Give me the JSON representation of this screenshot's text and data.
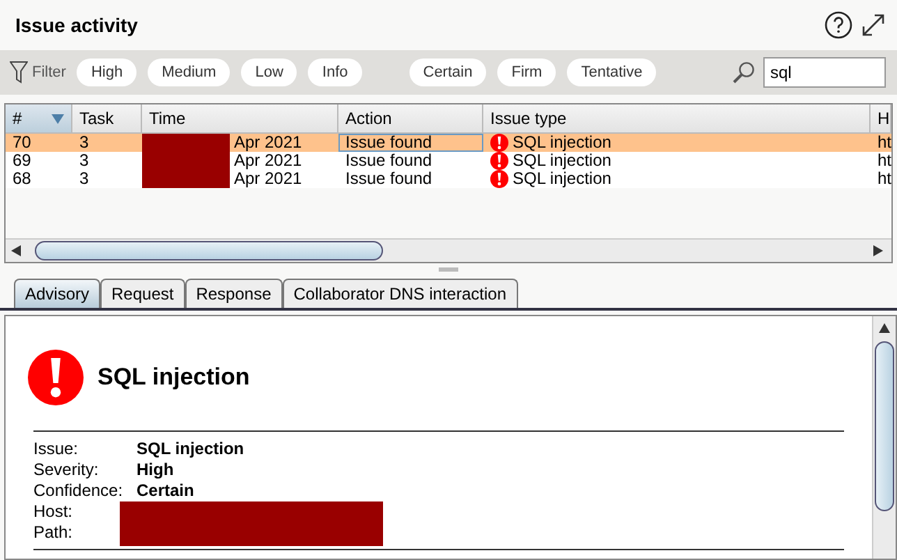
{
  "title": "Issue activity",
  "filter": {
    "label": "Filter",
    "severity_chips": [
      "High",
      "Medium",
      "Low",
      "Info"
    ],
    "confidence_chips": [
      "Certain",
      "Firm",
      "Tentative"
    ]
  },
  "search": {
    "value": "sql"
  },
  "table": {
    "columns": [
      {
        "label": "#",
        "sorted": true
      },
      {
        "label": "Task",
        "sorted": false
      },
      {
        "label": "Time",
        "sorted": false
      },
      {
        "label": "Action",
        "sorted": false
      },
      {
        "label": "Issue type",
        "sorted": false
      },
      {
        "label": "H",
        "sorted": false
      }
    ],
    "rows": [
      {
        "selected": true,
        "cells": [
          "70",
          "3",
          "Apr 2021",
          "Issue found",
          "SQL injection",
          "ht"
        ]
      },
      {
        "selected": false,
        "cells": [
          "69",
          "3",
          "Apr 2021",
          "Issue found",
          "SQL injection",
          "ht"
        ]
      },
      {
        "selected": false,
        "cells": [
          "68",
          "3",
          "Apr 2021",
          "Issue found",
          "SQL injection",
          "ht"
        ]
      }
    ]
  },
  "tabs": [
    {
      "label": "Advisory",
      "selected": true
    },
    {
      "label": "Request",
      "selected": false
    },
    {
      "label": "Response",
      "selected": false
    },
    {
      "label": "Collaborator DNS interaction",
      "selected": false
    }
  ],
  "advisory": {
    "title": "SQL injection",
    "fields": [
      {
        "label": "Issue:",
        "value": "SQL injection"
      },
      {
        "label": "Severity:",
        "value": "High"
      },
      {
        "label": "Confidence:",
        "value": "Certain"
      },
      {
        "label": "Host:"
      },
      {
        "label": "Path:"
      }
    ]
  }
}
